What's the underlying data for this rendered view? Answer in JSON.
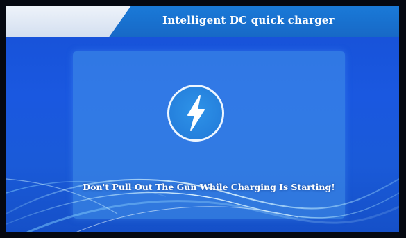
{
  "header": {
    "title": "Intelligent DC quick charger"
  },
  "main": {
    "status_icon": "lightning-bolt-icon",
    "message": "Don't Pull Out The Gun While Charging Is Starting!"
  },
  "colors": {
    "screen_background": "#1a58e0",
    "header_bar": "#1768c6",
    "header_tab": "#e3ebf6",
    "panel": "#4696eb",
    "icon_circle": "#2178d8"
  }
}
